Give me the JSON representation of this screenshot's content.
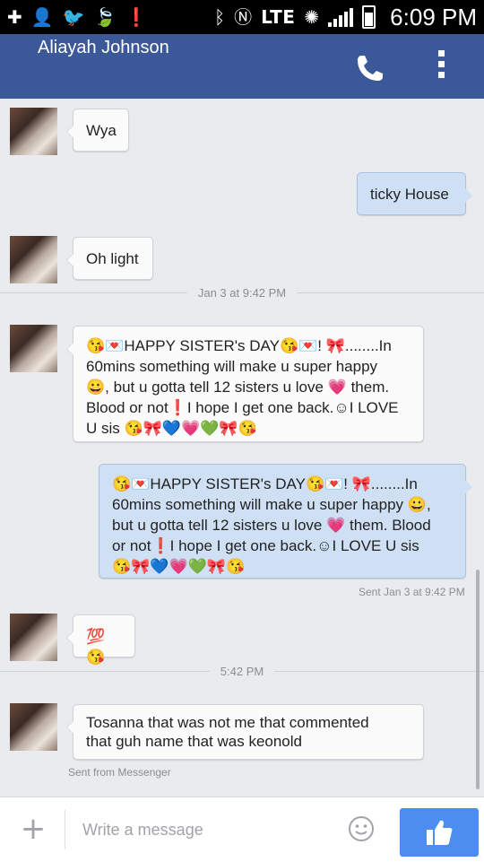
{
  "status_bar": {
    "network": "LTE",
    "time": "6:09 PM"
  },
  "header": {
    "contact_name": "Aliayah Johnson",
    "call_icon": "phone-icon",
    "menu_icon": "overflow-menu-icon"
  },
  "messages": {
    "m1": "Wya",
    "m2": "ticky House",
    "m3": "Oh light",
    "divider1": "Jan 3 at 9:42 PM",
    "m4_line1": "😘💌HAPPY SISTER's DAY😘💌! 🎀........In",
    "m4_line2": "60mins something will make u super happy",
    "m4_line3": "😀, but u gotta tell 12 sisters u love 💗 them.",
    "m4_line4": "Blood or not❗I hope I get one back.☺I LOVE",
    "m4_line5": "U sis  😘🎀💙💗💚🎀😘",
    "m5_line1": "😘💌HAPPY SISTER's DAY😘💌! 🎀........In",
    "m5_line2": "60mins something will make u super happy 😀,",
    "m5_line3": "but u gotta tell 12 sisters u love 💗 them. Blood",
    "m5_line4": "or not❗I hope I get one back.☺I LOVE U sis",
    "m5_line5": "😘🎀💙💗💚🎀😘",
    "m5_meta": "Sent Jan 3 at 9:42 PM",
    "m6": "💯 😘",
    "divider2": "5:42 PM",
    "m7_line1": "Tosanna that was not me that commented",
    "m7_line2": "that guh name that was keonold",
    "m7_meta": "Sent from Messenger"
  },
  "composer": {
    "placeholder": "Write a message",
    "plus_icon": "plus-icon",
    "emoji_icon": "smiley-icon",
    "like_icon": "thumbs-up-icon",
    "like_color": "#4c8ef0"
  },
  "colors": {
    "header_bg": "#3b5998",
    "incoming_bubble": "#fbfbfb",
    "outgoing_bubble": "#cfe0f5"
  }
}
